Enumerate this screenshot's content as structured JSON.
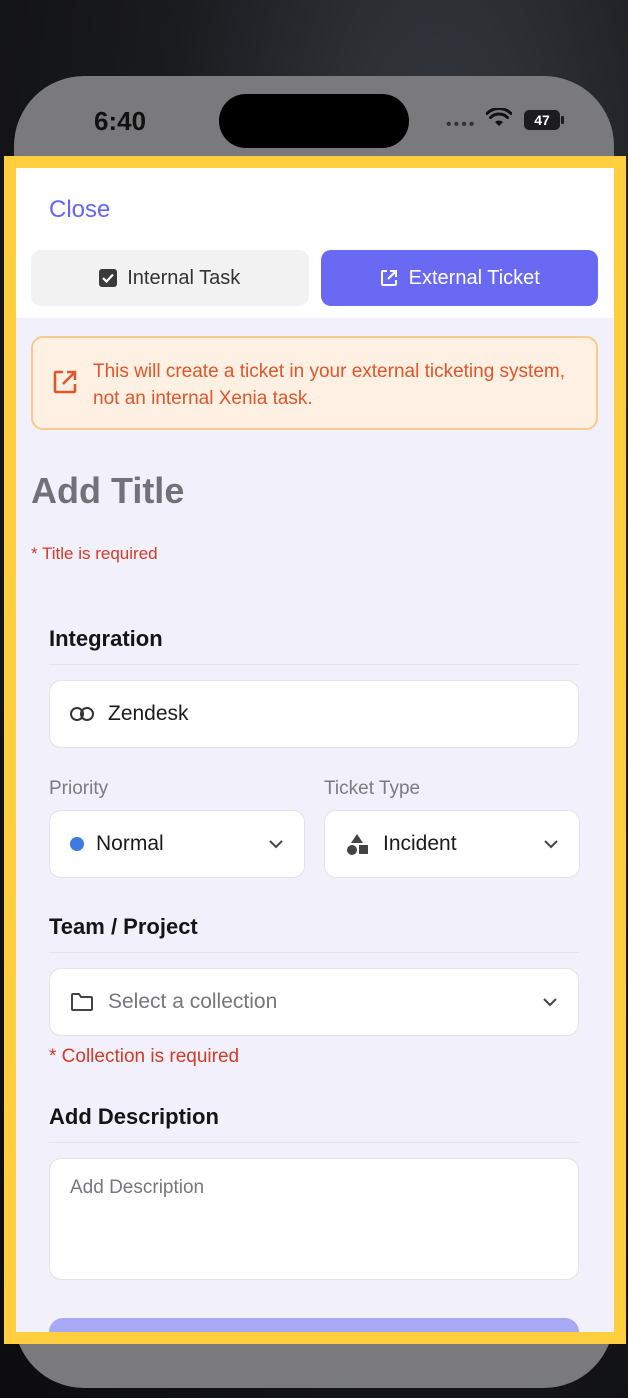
{
  "status": {
    "time": "6:40",
    "battery": "47"
  },
  "header": {
    "close_label": "Close"
  },
  "tabs": [
    {
      "label": "Internal Task",
      "active": false
    },
    {
      "label": "External Ticket",
      "active": true
    }
  ],
  "notice": {
    "text": "This will create a ticket in your external ticketing system, not an internal Xenia task."
  },
  "title": {
    "placeholder": "Add Title",
    "error": "* Title is required"
  },
  "integration": {
    "label": "Integration",
    "value": "Zendesk"
  },
  "priority": {
    "label": "Priority",
    "value": "Normal",
    "dot_color": "#3b7be0"
  },
  "ticket_type": {
    "label": "Ticket Type",
    "value": "Incident"
  },
  "team": {
    "label": "Team / Project",
    "placeholder": "Select a collection",
    "error": "* Collection is required"
  },
  "description": {
    "label": "Add Description",
    "placeholder": "Add Description"
  },
  "colors": {
    "accent": "#6a69f4",
    "warning": "#e0552a",
    "error": "#d23b26",
    "highlight": "#ffcf40"
  }
}
